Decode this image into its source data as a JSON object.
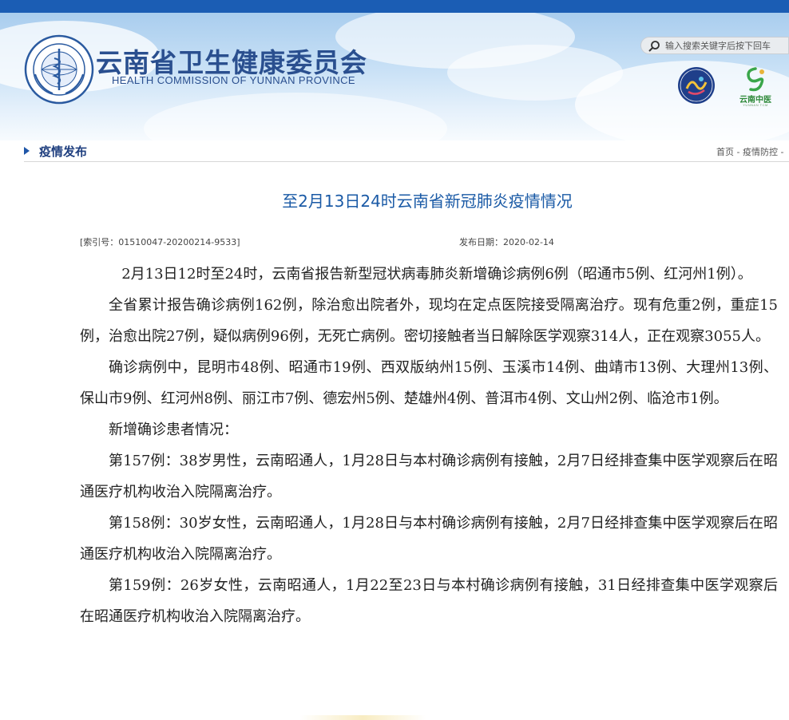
{
  "topnav": {
    "items": [
      "",
      "",
      "",
      "",
      "",
      "",
      "",
      "",
      ""
    ]
  },
  "header": {
    "title": "云南省卫生健康委员会",
    "subtitle": "HEALTH COMMISSION OF YUNNAN PROVINCE",
    "search_placeholder": "输入搜索关键字后按下回车",
    "badge_right_label": "云南中医",
    "badge_right_sub": "YUNNAN TCM"
  },
  "section": {
    "title": "疫情发布",
    "breadcrumb_home": "首页",
    "breadcrumb_sep": " - ",
    "breadcrumb_current": "疫情防控 -"
  },
  "article": {
    "title": "至2月13日24时云南省新冠肺炎疫情情况",
    "index_no": "[索引号：01510047-20200214-9533]",
    "publish_date": "发布日期：2020-02-14",
    "paragraphs": [
      "2月13日12时至24时，云南省报告新型冠状病毒肺炎新增确诊病例6例（昭通市5例、红河州1例）。",
      "全省累计报告确诊病例162例，除治愈出院者外，现均在定点医院接受隔离治疗。现有危重2例，重症15例，治愈出院27例，疑似病例96例，无死亡病例。密切接触者当日解除医学观察314人，正在观察3055人。",
      "确诊病例中，昆明市48例、昭通市19例、西双版纳州15例、玉溪市14例、曲靖市13例、大理州13例、保山市9例、红河州8例、丽江市7例、德宏州5例、楚雄州4例、普洱市4例、文山州2例、临沧市1例。",
      "新增确诊患者情况：",
      "第157例：38岁男性，云南昭通人，1月28日与本村确诊病例有接触，2月7日经排查集中医学观察后在昭通医疗机构收治入院隔离治疗。",
      "第158例：30岁女性，云南昭通人，1月28日与本村确诊病例有接触，2月7日经排查集中医学观察后在昭通医疗机构收治入院隔离治疗。",
      "第159例：26岁女性，云南昭通人，1月22至23日与本村确诊病例有接触，31日经排查集中医学观察后在昭通医疗机构收治入院隔离治疗。"
    ]
  },
  "colors": {
    "nav_bg": "#1b5db4",
    "title_blue": "#1a5aa6",
    "logo_text": "#2a4f8f",
    "section_text": "#1f3f7f"
  },
  "icons": {
    "search": "search-icon",
    "emblem": "health-commission-emblem-icon",
    "badge_left": "yunnan-badge-icon",
    "badge_right": "yunnan-tcm-logo-icon"
  }
}
